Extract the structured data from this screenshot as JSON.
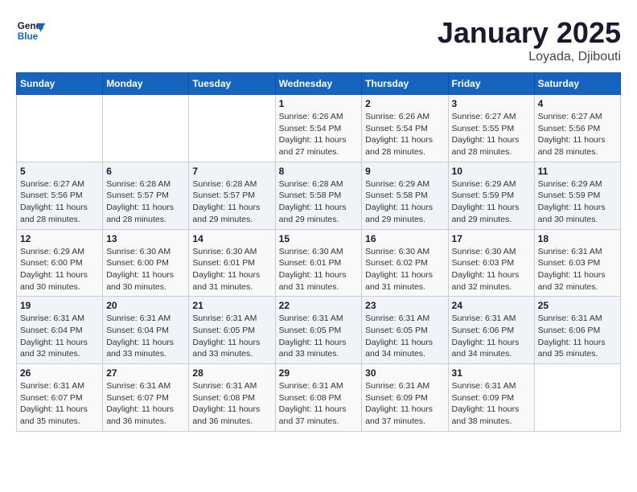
{
  "header": {
    "logo_line1": "General",
    "logo_line2": "Blue",
    "title": "January 2025",
    "subtitle": "Loyada, Djibouti"
  },
  "calendar": {
    "days_of_week": [
      "Sunday",
      "Monday",
      "Tuesday",
      "Wednesday",
      "Thursday",
      "Friday",
      "Saturday"
    ],
    "weeks": [
      [
        {
          "day": "",
          "info": ""
        },
        {
          "day": "",
          "info": ""
        },
        {
          "day": "",
          "info": ""
        },
        {
          "day": "1",
          "info": "Sunrise: 6:26 AM\nSunset: 5:54 PM\nDaylight: 11 hours and 27 minutes."
        },
        {
          "day": "2",
          "info": "Sunrise: 6:26 AM\nSunset: 5:54 PM\nDaylight: 11 hours and 28 minutes."
        },
        {
          "day": "3",
          "info": "Sunrise: 6:27 AM\nSunset: 5:55 PM\nDaylight: 11 hours and 28 minutes."
        },
        {
          "day": "4",
          "info": "Sunrise: 6:27 AM\nSunset: 5:56 PM\nDaylight: 11 hours and 28 minutes."
        }
      ],
      [
        {
          "day": "5",
          "info": "Sunrise: 6:27 AM\nSunset: 5:56 PM\nDaylight: 11 hours and 28 minutes."
        },
        {
          "day": "6",
          "info": "Sunrise: 6:28 AM\nSunset: 5:57 PM\nDaylight: 11 hours and 28 minutes."
        },
        {
          "day": "7",
          "info": "Sunrise: 6:28 AM\nSunset: 5:57 PM\nDaylight: 11 hours and 29 minutes."
        },
        {
          "day": "8",
          "info": "Sunrise: 6:28 AM\nSunset: 5:58 PM\nDaylight: 11 hours and 29 minutes."
        },
        {
          "day": "9",
          "info": "Sunrise: 6:29 AM\nSunset: 5:58 PM\nDaylight: 11 hours and 29 minutes."
        },
        {
          "day": "10",
          "info": "Sunrise: 6:29 AM\nSunset: 5:59 PM\nDaylight: 11 hours and 29 minutes."
        },
        {
          "day": "11",
          "info": "Sunrise: 6:29 AM\nSunset: 5:59 PM\nDaylight: 11 hours and 30 minutes."
        }
      ],
      [
        {
          "day": "12",
          "info": "Sunrise: 6:29 AM\nSunset: 6:00 PM\nDaylight: 11 hours and 30 minutes."
        },
        {
          "day": "13",
          "info": "Sunrise: 6:30 AM\nSunset: 6:00 PM\nDaylight: 11 hours and 30 minutes."
        },
        {
          "day": "14",
          "info": "Sunrise: 6:30 AM\nSunset: 6:01 PM\nDaylight: 11 hours and 31 minutes."
        },
        {
          "day": "15",
          "info": "Sunrise: 6:30 AM\nSunset: 6:01 PM\nDaylight: 11 hours and 31 minutes."
        },
        {
          "day": "16",
          "info": "Sunrise: 6:30 AM\nSunset: 6:02 PM\nDaylight: 11 hours and 31 minutes."
        },
        {
          "day": "17",
          "info": "Sunrise: 6:30 AM\nSunset: 6:03 PM\nDaylight: 11 hours and 32 minutes."
        },
        {
          "day": "18",
          "info": "Sunrise: 6:31 AM\nSunset: 6:03 PM\nDaylight: 11 hours and 32 minutes."
        }
      ],
      [
        {
          "day": "19",
          "info": "Sunrise: 6:31 AM\nSunset: 6:04 PM\nDaylight: 11 hours and 32 minutes."
        },
        {
          "day": "20",
          "info": "Sunrise: 6:31 AM\nSunset: 6:04 PM\nDaylight: 11 hours and 33 minutes."
        },
        {
          "day": "21",
          "info": "Sunrise: 6:31 AM\nSunset: 6:05 PM\nDaylight: 11 hours and 33 minutes."
        },
        {
          "day": "22",
          "info": "Sunrise: 6:31 AM\nSunset: 6:05 PM\nDaylight: 11 hours and 33 minutes."
        },
        {
          "day": "23",
          "info": "Sunrise: 6:31 AM\nSunset: 6:05 PM\nDaylight: 11 hours and 34 minutes."
        },
        {
          "day": "24",
          "info": "Sunrise: 6:31 AM\nSunset: 6:06 PM\nDaylight: 11 hours and 34 minutes."
        },
        {
          "day": "25",
          "info": "Sunrise: 6:31 AM\nSunset: 6:06 PM\nDaylight: 11 hours and 35 minutes."
        }
      ],
      [
        {
          "day": "26",
          "info": "Sunrise: 6:31 AM\nSunset: 6:07 PM\nDaylight: 11 hours and 35 minutes."
        },
        {
          "day": "27",
          "info": "Sunrise: 6:31 AM\nSunset: 6:07 PM\nDaylight: 11 hours and 36 minutes."
        },
        {
          "day": "28",
          "info": "Sunrise: 6:31 AM\nSunset: 6:08 PM\nDaylight: 11 hours and 36 minutes."
        },
        {
          "day": "29",
          "info": "Sunrise: 6:31 AM\nSunset: 6:08 PM\nDaylight: 11 hours and 37 minutes."
        },
        {
          "day": "30",
          "info": "Sunrise: 6:31 AM\nSunset: 6:09 PM\nDaylight: 11 hours and 37 minutes."
        },
        {
          "day": "31",
          "info": "Sunrise: 6:31 AM\nSunset: 6:09 PM\nDaylight: 11 hours and 38 minutes."
        },
        {
          "day": "",
          "info": ""
        }
      ]
    ]
  }
}
